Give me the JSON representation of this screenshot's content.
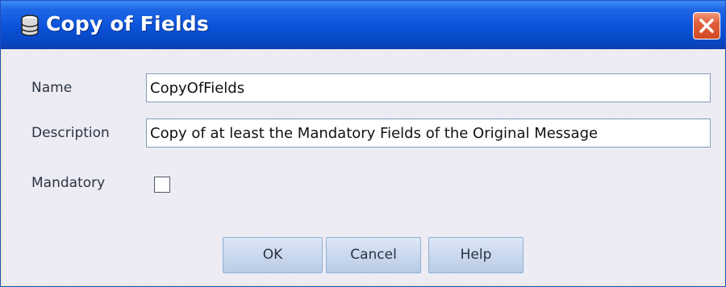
{
  "window": {
    "title": "Copy of Fields",
    "icon": "database-icon",
    "close_icon": "close-icon"
  },
  "form": {
    "name": {
      "label": "Name",
      "value": "CopyOfFields"
    },
    "description": {
      "label": "Description",
      "value": "Copy of at least the Mandatory Fields of the Original Message"
    },
    "mandatory": {
      "label": "Mandatory",
      "checked": false
    }
  },
  "buttons": {
    "ok": "OK",
    "cancel": "Cancel",
    "help": "Help"
  },
  "colors": {
    "titlebar": "#0a52d8",
    "close_button": "#d24a26",
    "body_background": "#ebeaf3"
  }
}
